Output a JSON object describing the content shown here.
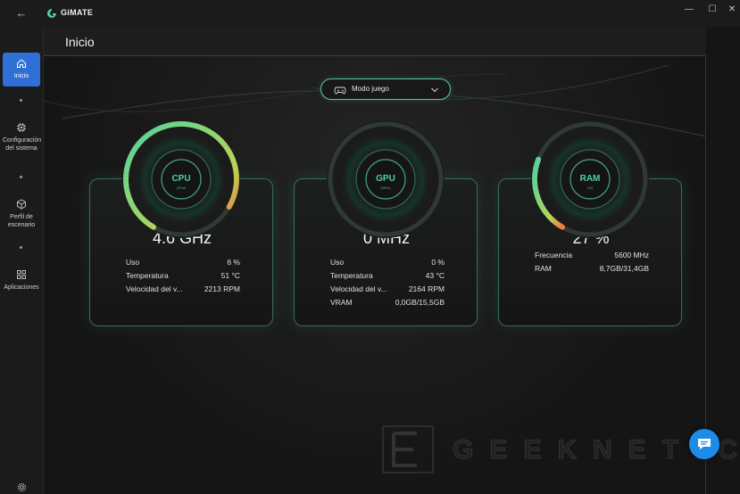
{
  "app": {
    "name": "GiMATE"
  },
  "window_controls": {
    "back": "←",
    "minimize": "—",
    "maximize": "☐",
    "close": "✕"
  },
  "sidebar": {
    "items": [
      {
        "label": "Inicio",
        "icon": "home-icon",
        "active": true
      },
      {
        "label": "Configuración del sistema",
        "icon": "chip-icon",
        "active": false
      },
      {
        "label": "Perfil de escenario",
        "icon": "cube-icon",
        "active": false
      },
      {
        "label": "Aplicaciones",
        "icon": "grid-icon",
        "active": false
      }
    ],
    "settings_icon": "gear-icon"
  },
  "header": {
    "title": "Inicio"
  },
  "mode": {
    "label": "Modo juego",
    "icon": "gamepad-icon"
  },
  "cards": [
    {
      "gauge_label": "CPU",
      "gauge_unit": "(GHz)",
      "value": "4.6 GHz",
      "fill": 0.9,
      "rows": [
        {
          "label": "Uso",
          "value": "6 %"
        },
        {
          "label": "Temperatura",
          "value": "51 °C"
        },
        {
          "label": "Velocidad del v...",
          "value": "2213 RPM"
        }
      ]
    },
    {
      "gauge_label": "GPU",
      "gauge_unit": "(MHz)",
      "value": "0 MHz",
      "fill": 0.0,
      "rows": [
        {
          "label": "Uso",
          "value": "0 %"
        },
        {
          "label": "Temperatura",
          "value": "43 °C"
        },
        {
          "label": "Velocidad del v...",
          "value": "2164 RPM"
        },
        {
          "label": "VRAM",
          "value": "0,0GB/15,5GB"
        }
      ]
    },
    {
      "gauge_label": "RAM",
      "gauge_unit": "(%)",
      "value": "27 %",
      "fill": 0.27,
      "rows": [
        {
          "label": "Frecuencia",
          "value": "5600 MHz"
        },
        {
          "label": "RAM",
          "value": "8,7GB/31,4GB"
        }
      ]
    }
  ],
  "watermark": {
    "text": "GEEKNETIC"
  },
  "colors": {
    "accent": "#4fd39c",
    "active_nav": "#2f6fd6",
    "hot": "#f07a3a"
  }
}
